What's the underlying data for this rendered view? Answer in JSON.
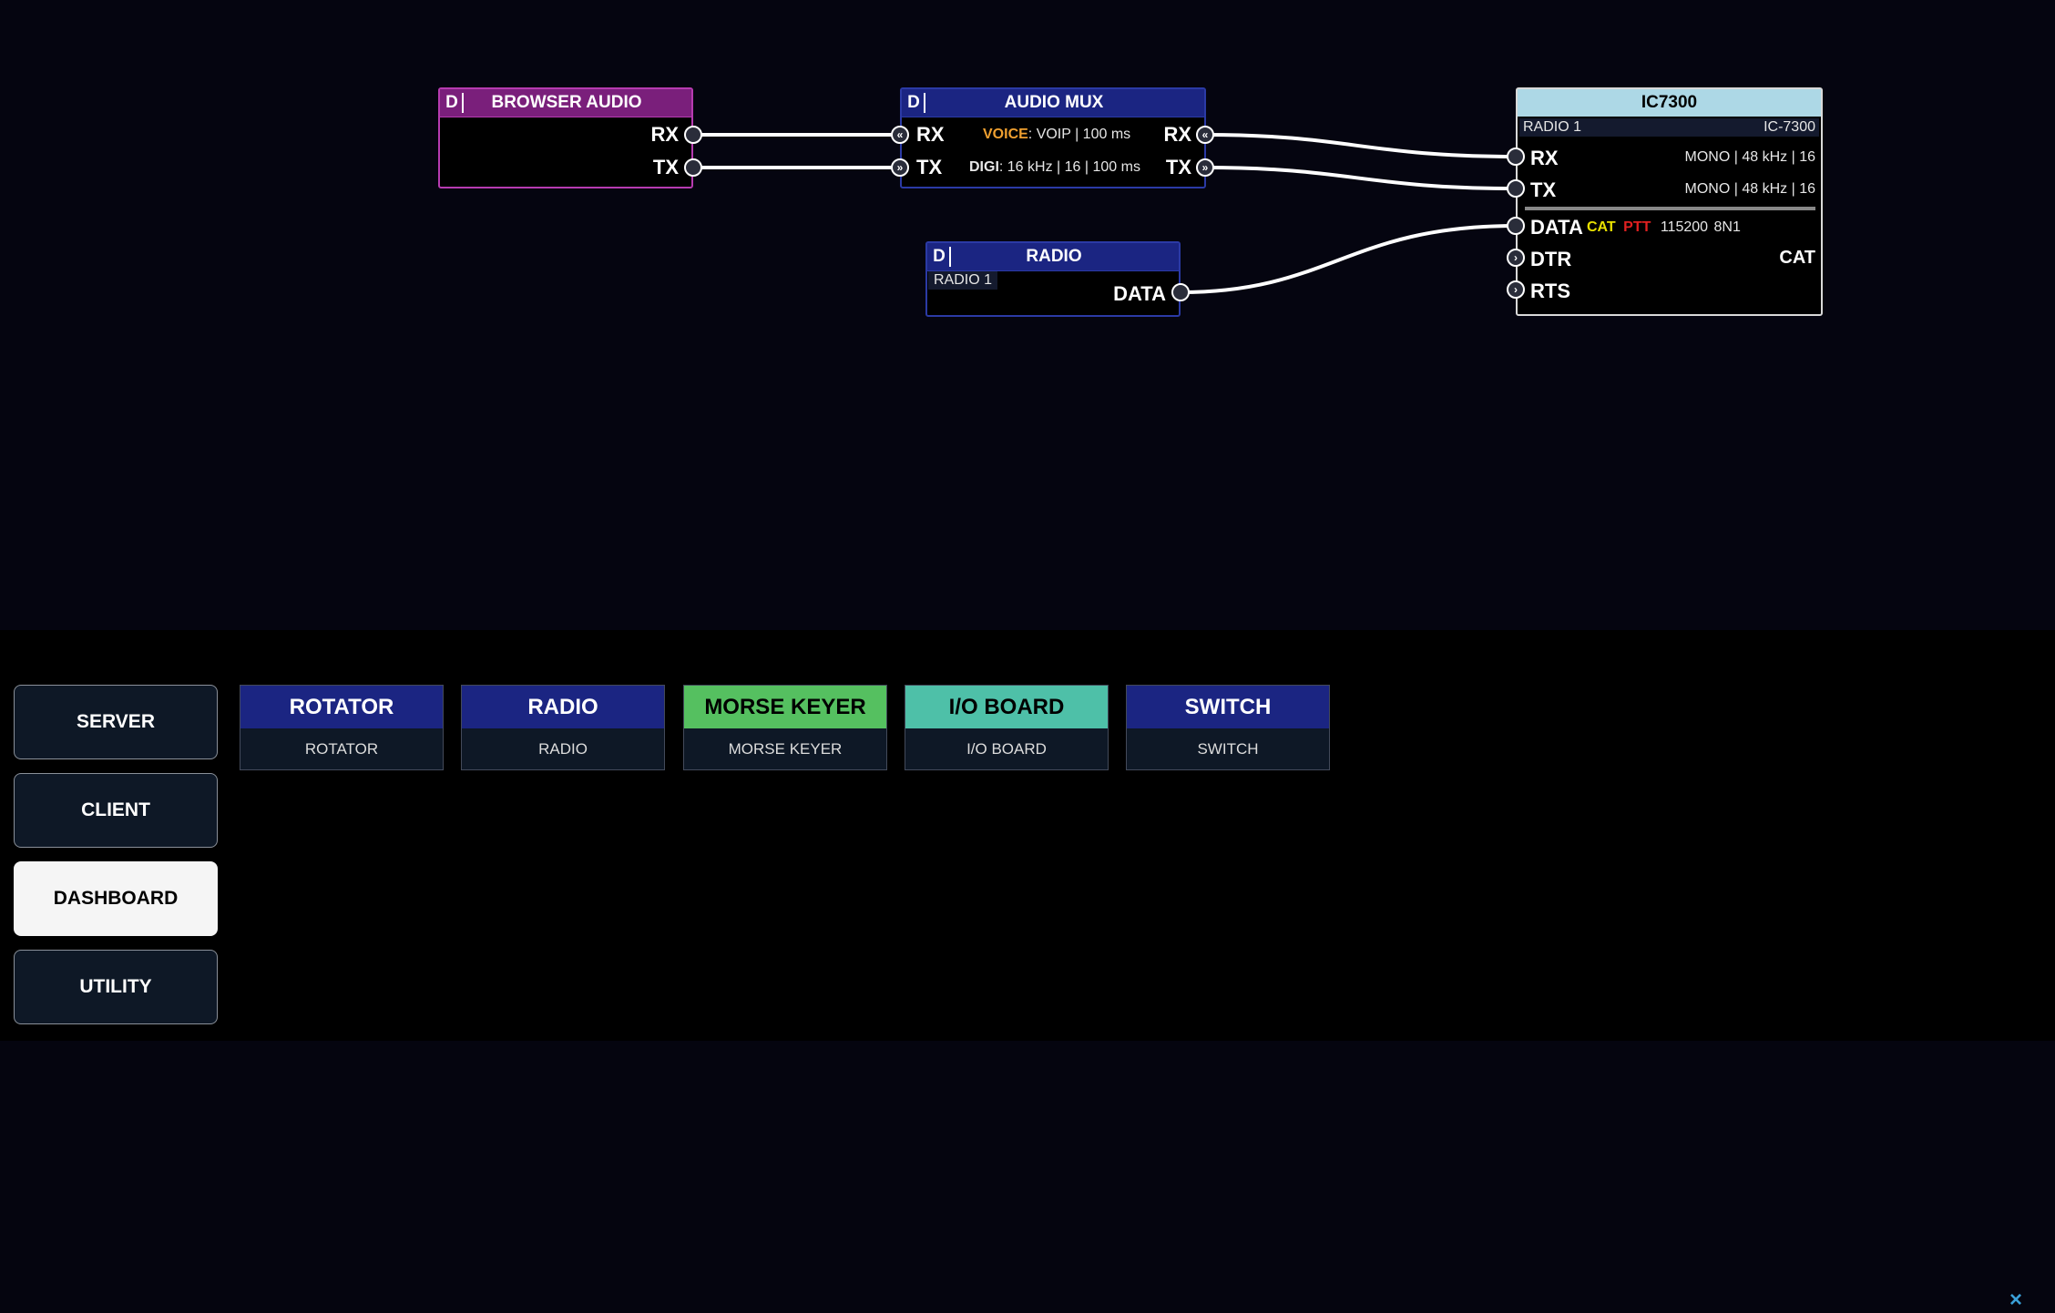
{
  "colors": {
    "canvas_bg": "#050510",
    "node_blue": "#1b2582",
    "node_purple": "#7a1f7b",
    "ic_header": "#add8e6",
    "voice_orange": "#f0a030",
    "cat_yellow": "#e8e000",
    "ptt_red": "#e02020",
    "close_blue": "#3aa0d8"
  },
  "nodes": {
    "browser_audio": {
      "d": "D",
      "title": "BROWSER AUDIO",
      "port_rx": "RX",
      "port_tx": "TX"
    },
    "audio_mux": {
      "d": "D",
      "title": "AUDIO MUX",
      "in_rx": "RX",
      "in_tx": "TX",
      "out_rx": "RX",
      "out_tx": "TX",
      "voice_label": "VOICE",
      "voice_value": ": VOIP | 100 ms",
      "digi_label": "DIGI",
      "digi_value": ": 16 kHz | 16 | 100 ms"
    },
    "radio": {
      "d": "D",
      "title": "RADIO",
      "subtitle": "RADIO 1",
      "port_data": "DATA"
    },
    "ic7300": {
      "title": "IC7300",
      "sub_left": "RADIO 1",
      "sub_right": "IC-7300",
      "port_rx": "RX",
      "rx_info": "MONO | 48 kHz | 16",
      "port_tx": "TX",
      "tx_info": "MONO | 48 kHz | 16",
      "port_data": "DATA",
      "data_cat": "CAT",
      "data_ptt": "PTT",
      "data_baud": "115200",
      "data_frame": "8N1",
      "port_dtr": "DTR",
      "dtr_right": "CAT",
      "port_rts": "RTS"
    }
  },
  "nav": {
    "server": "SERVER",
    "client": "CLIENT",
    "dashboard": "DASHBOARD",
    "utility": "UTILITY",
    "active": "DASHBOARD"
  },
  "palette": [
    {
      "title": "ROTATOR",
      "subtitle": "ROTATOR",
      "color": "#1b2582"
    },
    {
      "title": "RADIO",
      "subtitle": "RADIO",
      "color": "#1b2582"
    },
    {
      "title": "MORSE KEYER",
      "subtitle": "MORSE KEYER",
      "color": "#55c060"
    },
    {
      "title": "I/O BOARD",
      "subtitle": "I/O BOARD",
      "color": "#4ec0a8"
    },
    {
      "title": "SWITCH",
      "subtitle": "SWITCH",
      "color": "#1b2582"
    }
  ],
  "close_icon": "×"
}
